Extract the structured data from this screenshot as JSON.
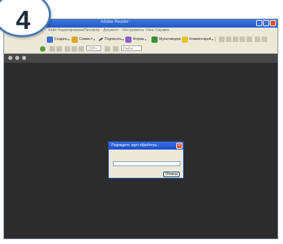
{
  "step": {
    "number": "4"
  },
  "window": {
    "title": "Adobe Reader",
    "menu": [
      "Файл",
      "Редактирование",
      "Просмотр",
      "Документ",
      "Инструменты",
      "Окно",
      "Справка"
    ]
  },
  "toolbar": {
    "tools": [
      {
        "label": "Создать",
        "icon": "create-icon",
        "color": "#3b6fd0"
      },
      {
        "label": "Совмест",
        "icon": "collaborate-icon",
        "color": "#e2a22c"
      },
      {
        "label": "Подписать",
        "icon": "sign-icon",
        "color": "#4a4a4a"
      },
      {
        "label": "Формы",
        "icon": "forms-icon",
        "color": "#8a5fc7"
      },
      {
        "label": "Мультимедиа",
        "icon": "multimedia-icon",
        "color": "#3a8f3a"
      },
      {
        "label": "Комментарий",
        "icon": "comment-icon",
        "color": "#e6c22a"
      }
    ],
    "zoom_value": "100%",
    "find_placeholder": "Найти"
  },
  "dialog": {
    "title": "Подождите, идет обработка...",
    "cancel_label": "Отмена",
    "progress": 0
  }
}
